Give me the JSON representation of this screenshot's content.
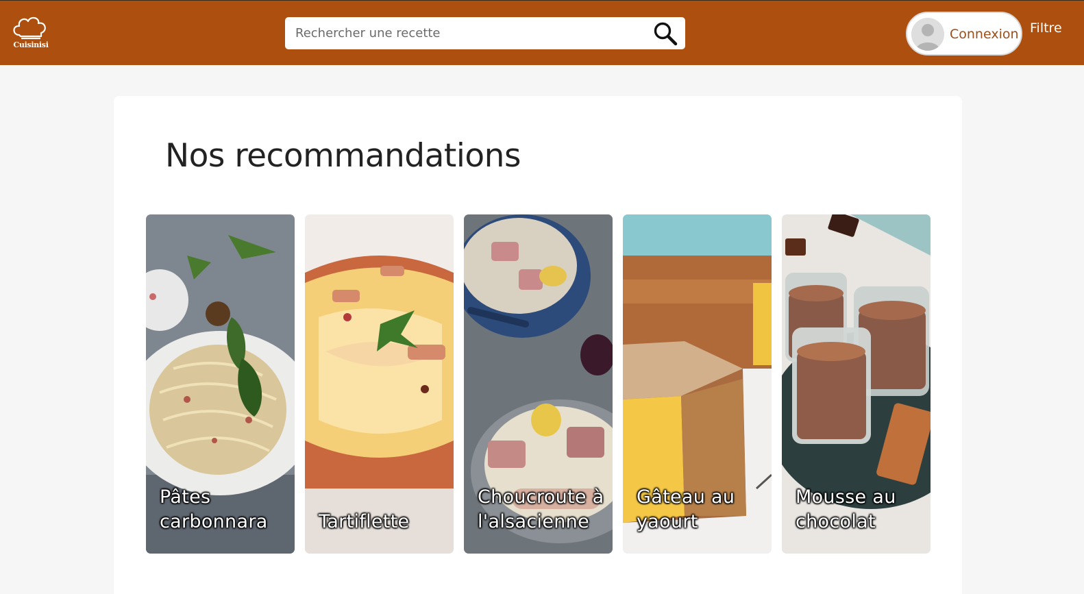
{
  "header": {
    "logo_text": "Cuisinisi",
    "search": {
      "placeholder": "Rechercher une recette"
    },
    "login_label": "Connexion",
    "filter_label": "Filtre"
  },
  "main": {
    "title": "Nos recommandations",
    "recipes": [
      {
        "label": "Pâtes carbonnara"
      },
      {
        "label": "Tartiflette"
      },
      {
        "label": "Choucroute à l'alsacienne"
      },
      {
        "label": "Gâteau au yaourt"
      },
      {
        "label": "Mousse au chocolat"
      }
    ]
  },
  "colors": {
    "header": "#ad4f0e",
    "accent_text": "#9a4f1a",
    "background": "#f6f6f6"
  },
  "icons": [
    "chef-hat-logo-icon",
    "search-icon",
    "user-avatar-icon"
  ]
}
